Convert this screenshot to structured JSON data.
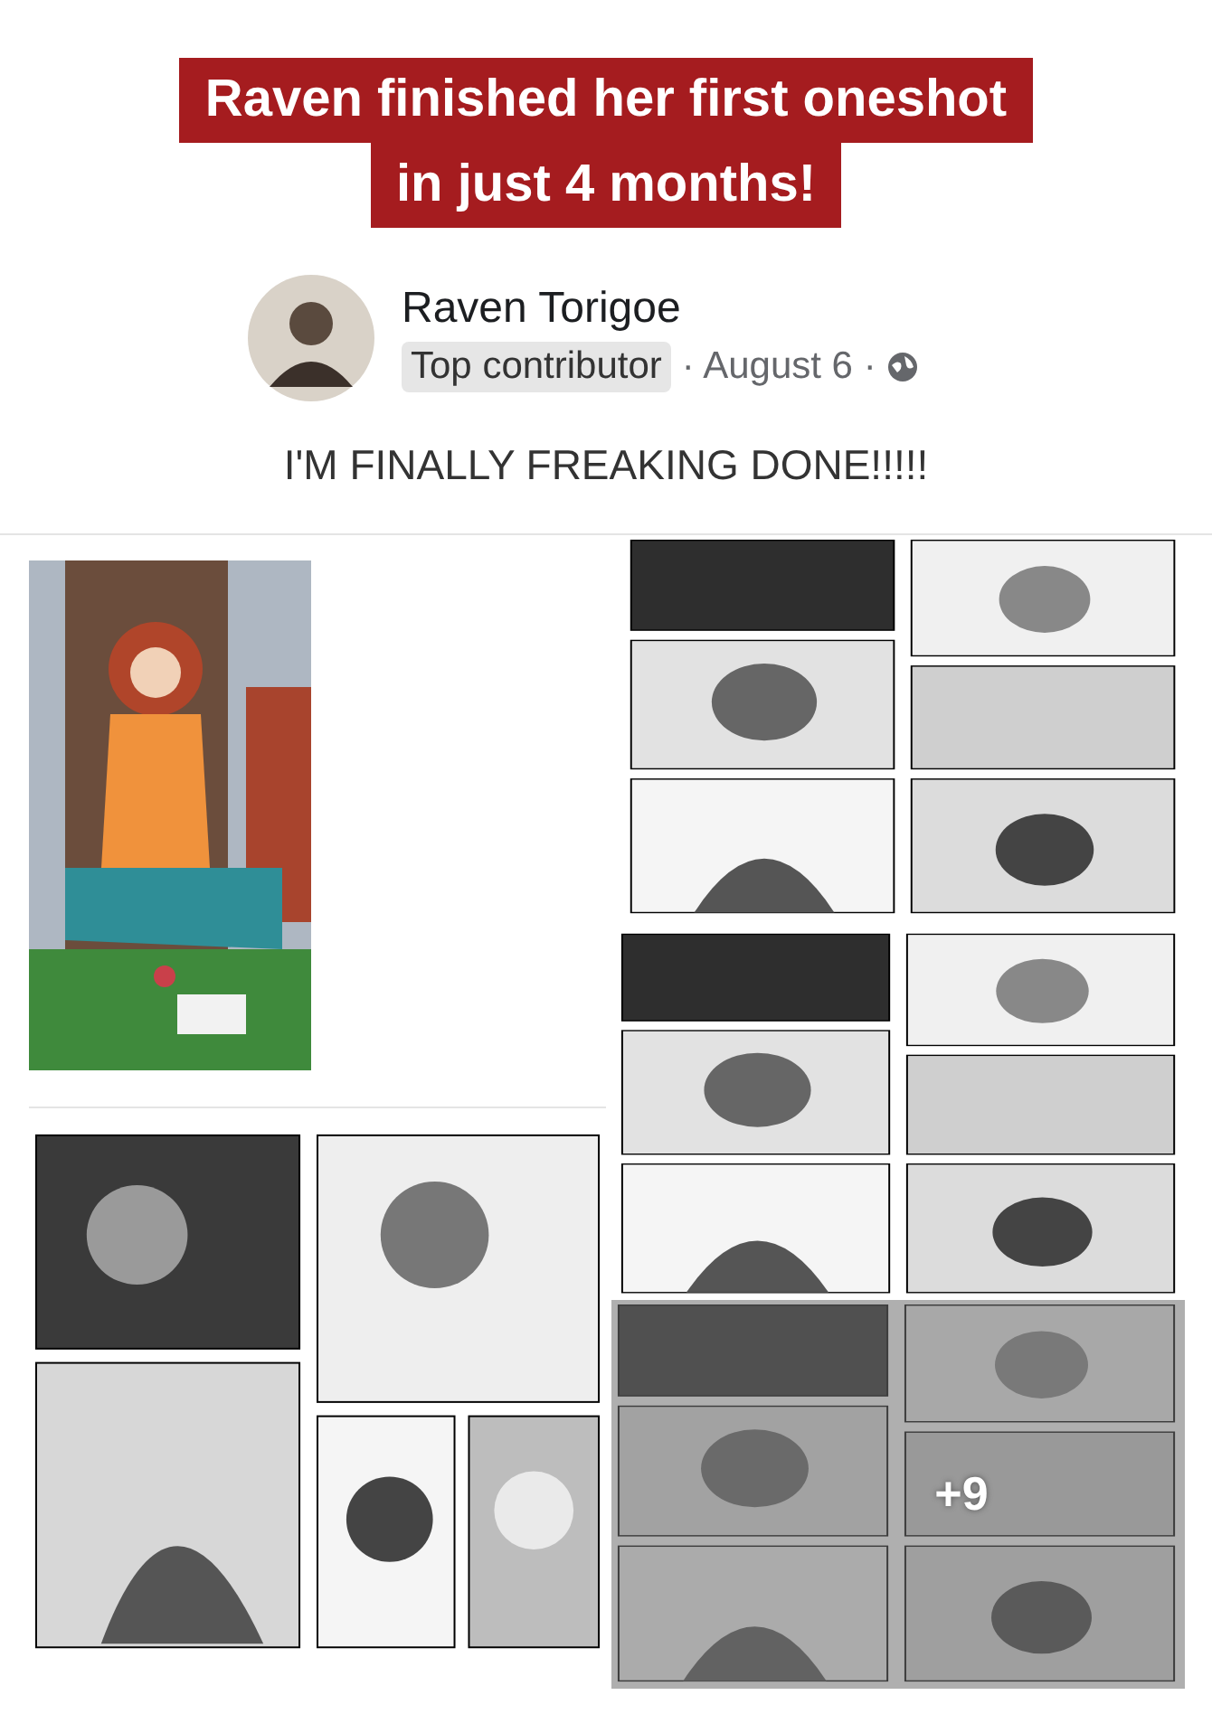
{
  "headline_lines": [
    "Raven finished her first oneshot",
    "in just 4 months!"
  ],
  "post": {
    "author": "Raven Torigoe",
    "badge": "Top contributor",
    "date": "· August 6 ·",
    "text": "I'M FINALLY FREAKING DONE!!!!!"
  },
  "media": {
    "more_count": "+9"
  }
}
